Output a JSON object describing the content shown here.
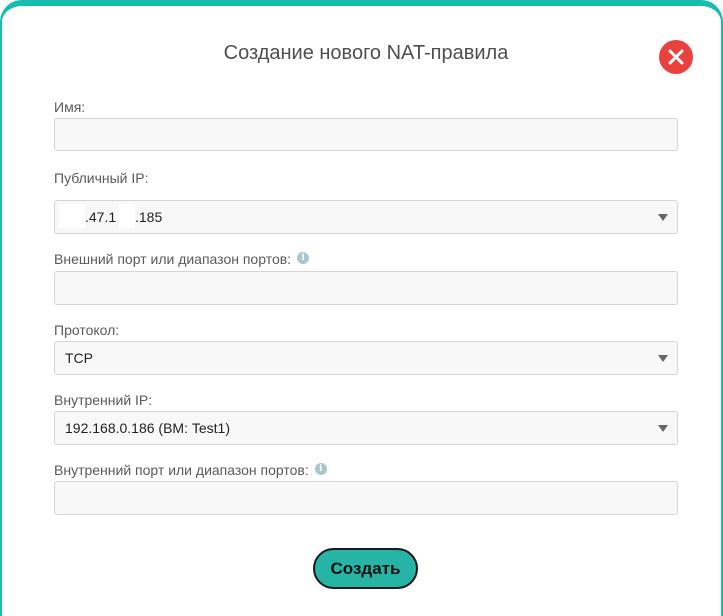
{
  "dialog": {
    "title": "Создание нового NAT-правила",
    "close_icon": "close-icon"
  },
  "fields": {
    "name": {
      "label": "Имя:",
      "value": ""
    },
    "public_ip": {
      "label": "Публичный IP:",
      "value_part1": ".47.1",
      "value_part2": ".185"
    },
    "external_port": {
      "label": "Внешний порт или диапазон портов:",
      "value": "",
      "info_icon": "info-icon"
    },
    "protocol": {
      "label": "Протокол:",
      "value": "TCP"
    },
    "internal_ip": {
      "label": "Внутренний IP:",
      "value": "192.168.0.186 (ВМ: Test1)"
    },
    "internal_port": {
      "label": "Внутренний порт или диапазон портов:",
      "value": "",
      "info_icon": "info-icon"
    }
  },
  "actions": {
    "create_label": "Создать"
  },
  "colors": {
    "accent": "#19bdb0",
    "button": "#26b4a6",
    "close": "#e8413e"
  }
}
